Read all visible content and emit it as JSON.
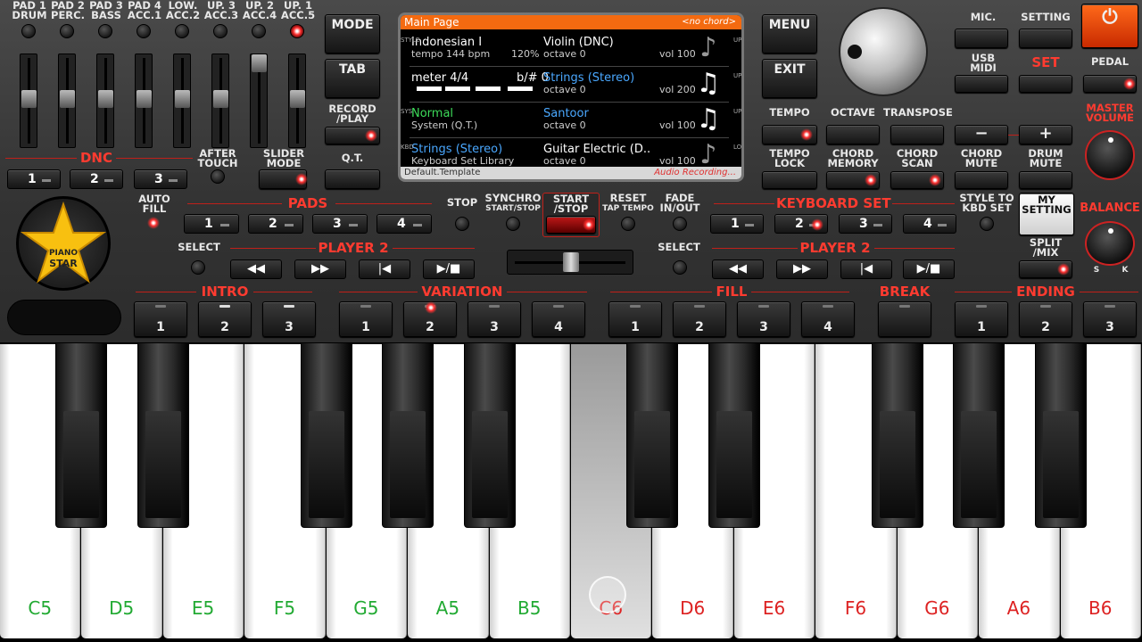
{
  "pads": {
    "labels": [
      {
        "top": "PAD 1",
        "bottom": "DRUM"
      },
      {
        "top": "PAD 2",
        "bottom": "PERC."
      },
      {
        "top": "PAD 3",
        "bottom": "BASS"
      },
      {
        "top": "PAD 4",
        "bottom": "ACC.1"
      },
      {
        "top": "LOW.",
        "bottom": "ACC.2"
      },
      {
        "top": "UP. 3",
        "bottom": "ACC.3"
      },
      {
        "top": "UP. 2",
        "bottom": "ACC.4"
      },
      {
        "top": "UP. 1",
        "bottom": "ACC.5"
      }
    ]
  },
  "dnc": {
    "title": "DNC",
    "buttons": [
      "1",
      "2",
      "3"
    ]
  },
  "after_touch": "AFTER\nTOUCH",
  "slider_mode": "SLIDER\nMODE",
  "left_buttons": {
    "mode": "MODE",
    "tab": "TAB",
    "record_play": "RECORD\n/PLAY",
    "qt": "Q.T."
  },
  "lcd": {
    "header": "Main Page",
    "chord": "<no chord>",
    "rows": [
      {
        "l1": "Indonesian I",
        "l1b": "",
        "l2": "tempo 144 bpm",
        "l2b": "120%",
        "r1": "Violin (DNC)",
        "r2": "octave  0",
        "r2b": "vol 100",
        "icon": "violin-icon"
      },
      {
        "l1": "meter 4/4",
        "l1b": "b/# 0",
        "l2": "",
        "l2b": "",
        "r1": "Strings (Stereo)",
        "r2": "octave  0",
        "r2b": "vol 200",
        "icon": "music-note-icon"
      },
      {
        "l1": "Normal",
        "l1b": "",
        "l2": "System (Q.T.)",
        "l2b": "",
        "r1": "Santoor",
        "r2": "octave  0",
        "r2b": "vol 100",
        "icon": "music-note-icon"
      },
      {
        "l1": "Strings (Stereo)",
        "l1b": "",
        "l2": "Keyboard Set Library",
        "l2b": "",
        "r1": "Guitar Electric (D..",
        "r2": "octave  0",
        "r2b": "vol 100",
        "icon": "guitar-icon"
      }
    ],
    "left_side": [
      "STYLE",
      "",
      "SYS",
      "KBD"
    ],
    "right_side": [
      "UP1",
      "UP2",
      "UP3",
      "LOW"
    ],
    "footer": "Default.Template",
    "footer_right": "Audio Recording..."
  },
  "right_top": {
    "menu": "MENU",
    "exit": "EXIT",
    "mic": "MIC.",
    "setting": "SETTING",
    "usb_midi": "USB\nMIDI",
    "set": "SET",
    "pedal": "PEDAL",
    "master_volume": "MASTER\nVOLUME",
    "balance": "BALANCE"
  },
  "tempo_row": {
    "tempo": "TEMPO",
    "octave": "OCTAVE",
    "transpose": "TRANSPOSE",
    "minus": "−",
    "plus": "+"
  },
  "second_row": {
    "tempo_lock": "TEMPO\nLOCK",
    "chord_memory": "CHORD\nMEMORY",
    "chord_scan": "CHORD\nSCAN",
    "chord_mute": "CHORD\nMUTE",
    "drum_mute": "DRUM\nMUTE"
  },
  "middle": {
    "auto_fill": "AUTO\nFILL",
    "pads": "PADS",
    "pad_buttons": [
      "1",
      "2",
      "3",
      "4"
    ],
    "stop": "STOP",
    "synchro": "SYNCHRO",
    "start_stop_small": "START/STOP",
    "start_stop": "START\n/STOP",
    "reset": "RESET",
    "tap_tempo": "TAP TEMPO",
    "fade": "FADE\nIN/OUT",
    "keyboard_set": "KEYBOARD SET",
    "kbd_buttons": [
      "1",
      "2",
      "3",
      "4"
    ],
    "style_to_kbd": "STYLE TO\nKBD SET",
    "my_setting": "MY\nSETTING",
    "split_mix": "SPLIT\n/MIX",
    "select": "SELECT",
    "player": "PLAYER 2"
  },
  "sections": {
    "intro": {
      "title": "INTRO",
      "buttons": [
        "1",
        "2",
        "3"
      ]
    },
    "variation": {
      "title": "VARIATION",
      "buttons": [
        "1",
        "2",
        "3",
        "4"
      ]
    },
    "fill": {
      "title": "FILL",
      "buttons": [
        "1",
        "2",
        "3",
        "4"
      ]
    },
    "break": {
      "title": "BREAK"
    },
    "ending": {
      "title": "ENDING",
      "buttons": [
        "1",
        "2",
        "3"
      ]
    }
  },
  "logo": {
    "line1": "PIANO",
    "line2": "STAR"
  },
  "balance_marks": {
    "left": "S",
    "right": "K"
  },
  "keys": [
    {
      "name": "C5",
      "color": "#22aa33"
    },
    {
      "name": "D5",
      "color": "#22aa33"
    },
    {
      "name": "E5",
      "color": "#22aa33"
    },
    {
      "name": "F5",
      "color": "#22aa33"
    },
    {
      "name": "G5",
      "color": "#22aa33"
    },
    {
      "name": "A5",
      "color": "#22aa33"
    },
    {
      "name": "B5",
      "color": "#22aa33"
    },
    {
      "name": "C6",
      "color": "#dd2222",
      "pressed": true
    },
    {
      "name": "D6",
      "color": "#dd2222"
    },
    {
      "name": "E6",
      "color": "#dd2222"
    },
    {
      "name": "F6",
      "color": "#dd2222"
    },
    {
      "name": "G6",
      "color": "#dd2222"
    },
    {
      "name": "A6",
      "color": "#dd2222"
    },
    {
      "name": "B6",
      "color": "#dd2222"
    }
  ]
}
